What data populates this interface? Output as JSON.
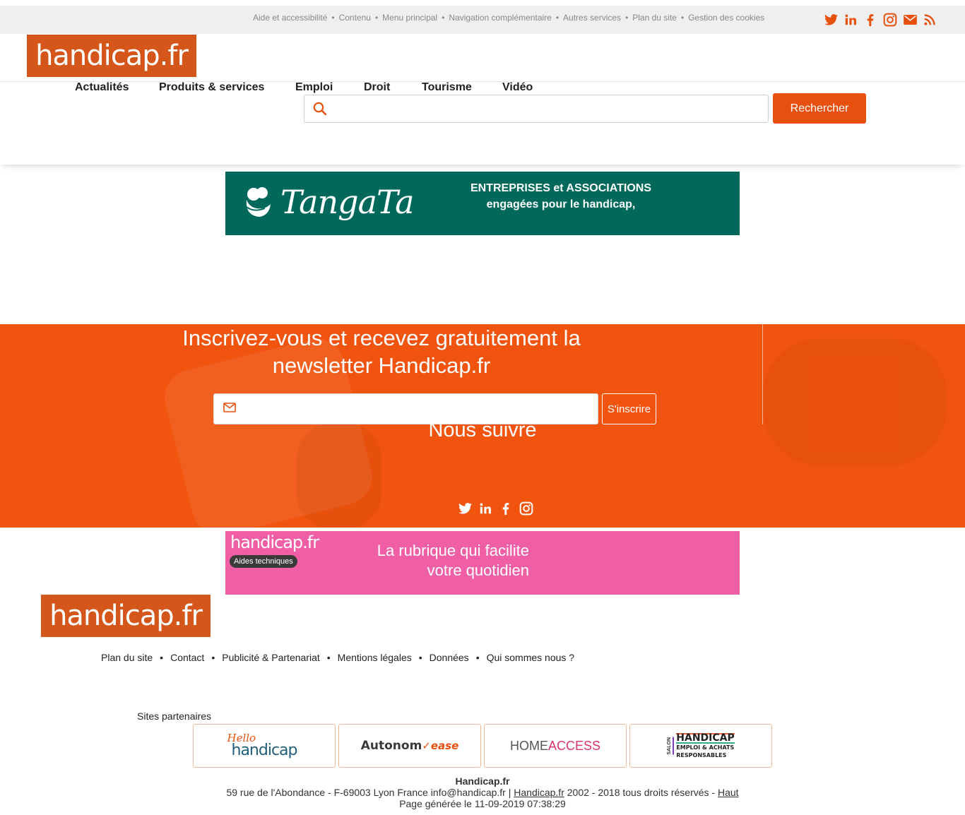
{
  "top_links": [
    "Aide et accessibilité",
    "Contenu",
    "Menu principal",
    "Navigation complémentaire",
    "Autres services",
    "Plan du site",
    "Gestion des cookies"
  ],
  "top_social_icons": [
    "twitter-icon",
    "linkedin-icon",
    "facebook-icon",
    "instagram-icon",
    "email-icon",
    "rss-icon"
  ],
  "logo_text": "handicap.fr",
  "nav": [
    "Actualités",
    "Produits & services",
    "Emploi",
    "Droit",
    "Tourisme",
    "Vidéo"
  ],
  "search": {
    "placeholder": "",
    "value": "",
    "button": "Rechercher"
  },
  "banner_tangata": {
    "logo": "TangaTa",
    "line1": "ENTREPRISES et ASSOCIATIONS",
    "line2": "engagées pour le handicap,"
  },
  "newsletter": {
    "title": "Inscrivez-vous et recevez gratuitement la newsletter Handicap.fr",
    "email_placeholder": "",
    "email_value": "",
    "button": "S'inscrire",
    "follow_title": "Nous suivre",
    "social_icons": [
      "twitter-icon",
      "linkedin-icon",
      "facebook-icon",
      "instagram-icon"
    ]
  },
  "banner_aides": {
    "logo": "handicap.fr",
    "pill": "Aides techniques",
    "line1": "La rubrique  qui facilite",
    "line2": "votre quotidien"
  },
  "footer_links": [
    "Plan du site",
    "Contact",
    "Publicité & Partenariat",
    "Mentions légales",
    "Données",
    "Qui sommes nous ?"
  ],
  "partners": {
    "label": "Sites partenaires",
    "hello_top": "Hello",
    "hello_bottom": "handicap",
    "autonom": "Autonom",
    "autonom_ease": "ease",
    "home": "HOME",
    "access": "ACCESS",
    "salon_side": "SALON",
    "salon_big": "HANDICAP",
    "salon_small1": "EMPLOI & ACHATS",
    "salon_small2": "RESPONSABLES"
  },
  "footer_info": {
    "name": "Handicap.fr",
    "address": "59 rue de l'Abondance - F-69003 Lyon France info@handicap.fr | ",
    "site_link": "Handicap.fr",
    "rights": " 2002 - 2018 tous droits réservés - ",
    "top_link": "Haut",
    "generated": "Page générée le 11-09-2019 07:38:29"
  },
  "colors": {
    "brand": "#d4561a",
    "accent": "#e8500f",
    "tangata_bg": "#00695c",
    "aides_bg": "#f05fa6",
    "topbar_bg": "#efefef"
  }
}
